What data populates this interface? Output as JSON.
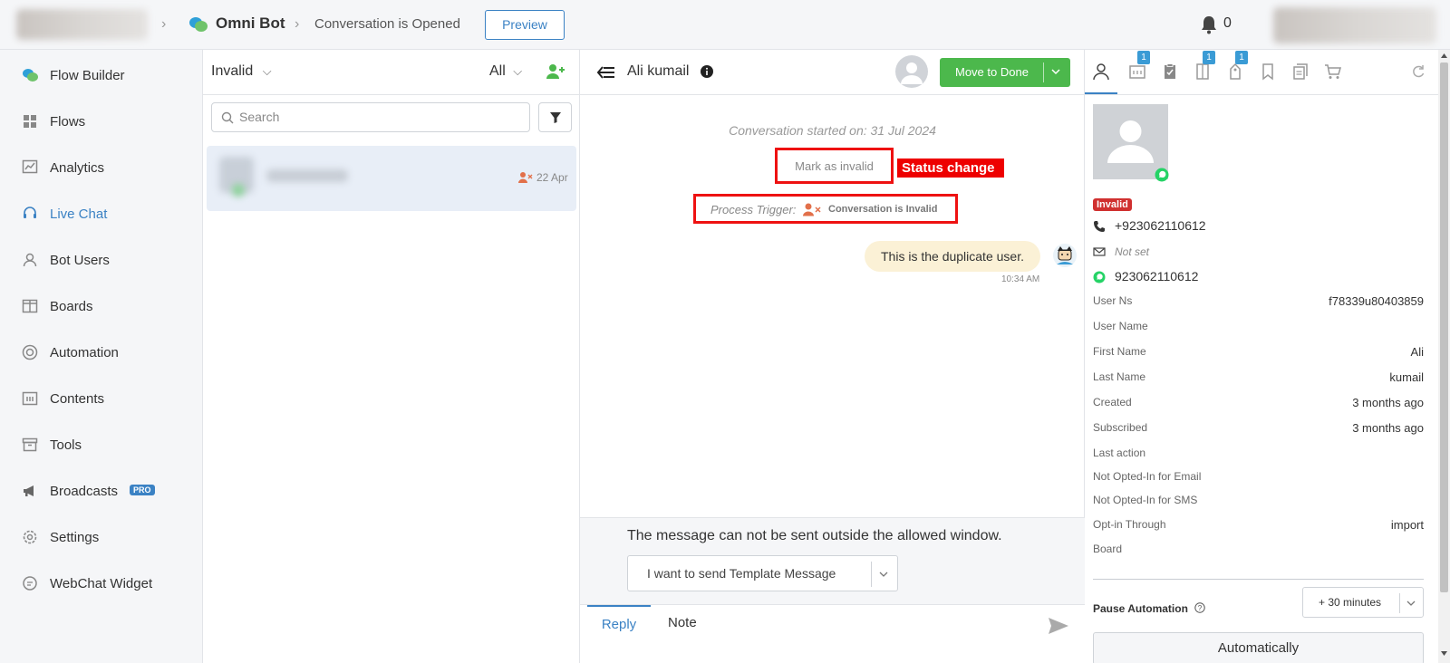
{
  "header": {
    "brand_name": "Omni Bot",
    "breadcrumb_current": "Conversation is Opened",
    "preview_label": "Preview",
    "notification_count": "0"
  },
  "sidebar": {
    "items": [
      {
        "label": "Flow Builder",
        "icon": "chat-bubbles-icon"
      },
      {
        "label": "Flows",
        "icon": "grid-icon"
      },
      {
        "label": "Analytics",
        "icon": "chart-icon"
      },
      {
        "label": "Live Chat",
        "icon": "headset-icon",
        "active": true
      },
      {
        "label": "Bot Users",
        "icon": "user-icon"
      },
      {
        "label": "Boards",
        "icon": "board-icon"
      },
      {
        "label": "Automation",
        "icon": "automation-icon"
      },
      {
        "label": "Contents",
        "icon": "contents-icon"
      },
      {
        "label": "Tools",
        "icon": "archive-icon"
      },
      {
        "label": "Broadcasts",
        "icon": "megaphone-icon",
        "badge": "PRO"
      },
      {
        "label": "Settings",
        "icon": "gear-icon"
      },
      {
        "label": "WebChat Widget",
        "icon": "chat-icon"
      }
    ]
  },
  "conversations": {
    "filter_label": "Invalid",
    "scope_label": "All",
    "search_placeholder": "Search",
    "items": [
      {
        "date": "22 Apr"
      }
    ]
  },
  "chat": {
    "contact_name": "Ali kumail",
    "move_to_done_label": "Move to Done",
    "started_text": "Conversation started on: 31 Jul 2024",
    "mark_invalid_text": "Mark as invalid",
    "status_change_annotation": "Status change",
    "process_trigger_label": "Process Trigger:",
    "process_trigger_value": "Conversation is Invalid",
    "message_text": "This is the duplicate user.",
    "message_time": "10:34 AM",
    "window_notice": "The message can not be sent outside the allowed window.",
    "template_select_label": "I want to send Template Message",
    "tab_reply": "Reply",
    "tab_note": "Note"
  },
  "profile": {
    "tab_badges": [
      "1",
      "1",
      "1"
    ],
    "status_badge": "Invalid",
    "phone": "+923062110612",
    "email": "Not set",
    "whatsapp": "923062110612",
    "fields": [
      {
        "key": "User Ns",
        "value": "f78339u80403859"
      },
      {
        "key": "User Name",
        "value": ""
      },
      {
        "key": "First Name",
        "value": "Ali"
      },
      {
        "key": "Last Name",
        "value": "kumail"
      },
      {
        "key": "Created",
        "value": "3 months ago"
      },
      {
        "key": "Subscribed",
        "value": "3 months ago"
      },
      {
        "key": "Last action",
        "value": ""
      },
      {
        "key": "Not Opted-In for Email",
        "value": ""
      },
      {
        "key": "Not Opted-In for SMS",
        "value": ""
      },
      {
        "key": "Opt-in Through",
        "value": "import"
      },
      {
        "key": "Board",
        "value": ""
      }
    ],
    "pause_automation_label": "Pause Automation",
    "pause_select_value": "+ 30 minutes",
    "automatically_label": "Automatically"
  },
  "colors": {
    "accent": "#3b82c4",
    "success": "#4cb84c",
    "danger": "#d0302f",
    "annotation_red": "#ee1111"
  }
}
